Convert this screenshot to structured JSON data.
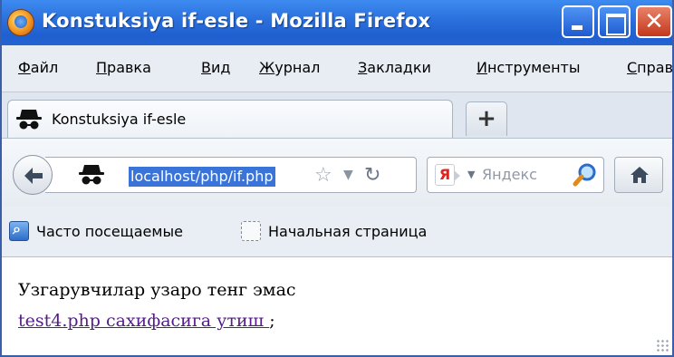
{
  "window": {
    "title": "Konstuksiya if-esle - Mozilla Firefox"
  },
  "menu": [
    "Файл",
    "Правка",
    "Вид",
    "Журнал",
    "Закладки",
    "Инструменты",
    "Справка"
  ],
  "tabs": [
    {
      "label": "Konstuksiya if-esle",
      "icon": "spy-icon"
    }
  ],
  "navbar": {
    "url": "localhost/php/if.php",
    "search_placeholder": "Яндекс",
    "search_engine_logo": "Я"
  },
  "bookmarks": [
    {
      "label": "Часто посещаемые",
      "icon": "smart-folder-icon"
    },
    {
      "label": "Начальная страница",
      "icon": "blank-page-icon"
    }
  ],
  "content": {
    "line1": "Узгарувчилар узаро тенг эмас",
    "link_text": "test4.php сахифасига утиш ",
    "after_link": ";"
  },
  "colors": {
    "titlebar": "#2a6fdc",
    "url_selection": "#3a74d8",
    "visited_link": "#551a8b"
  }
}
